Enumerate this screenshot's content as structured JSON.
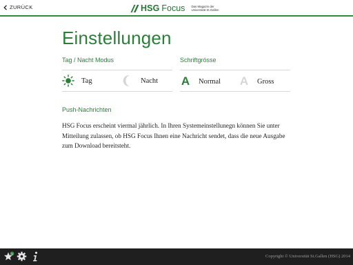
{
  "nav": {
    "back_label": "ZURÜCK"
  },
  "logo": {
    "brand": "HSG",
    "brand2": "Focus",
    "tagline_line1": "Das Magazin der",
    "tagline_line2": "Universität St.Gallen"
  },
  "page": {
    "title": "Einstellungen"
  },
  "settings": {
    "mode": {
      "label": "Tag / Nacht Modus",
      "options": [
        {
          "label": "Tag",
          "icon": "sun-icon",
          "selected": true
        },
        {
          "label": "Nacht",
          "icon": "moon-icon",
          "selected": false
        }
      ]
    },
    "font_size": {
      "label": "Schriftgrösse",
      "options": [
        {
          "label": "Normal",
          "glyph": "A",
          "selected": true
        },
        {
          "label": "Gross",
          "glyph": "A",
          "selected": false
        }
      ]
    }
  },
  "push": {
    "title": "Push-Nachrichten",
    "text": "HSG Focus erscheint viermal jährlich. In Ihren Systemeinstellunegn können Sie unter Mitteilung zulassen, ob HSG Focus Ihnen eine Nachricht sendet, dass die neue Ausgabe zum Download bereitsteht."
  },
  "footer": {
    "icons": [
      "star-badge-icon",
      "gear-icon",
      "info-icon"
    ],
    "copyright": "Copyright © Universität St.Gallen (HSG) 2014"
  },
  "colors": {
    "accent": "#2a7f38",
    "bar": "#1f1f1f",
    "muted": "#d0d0d0"
  }
}
